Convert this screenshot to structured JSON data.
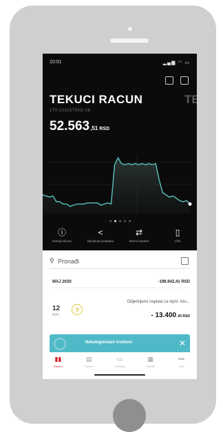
{
  "status": {
    "time": "10:01",
    "icons": "▂▄▆ ◠ ▭"
  },
  "account": {
    "title": "TEKUCI RACUN",
    "next_title": "TE",
    "number": "170-10115700O-28",
    "balance_main": "52.563",
    "balance_decimal": ",51",
    "currency": "RSD"
  },
  "balance_chart": {
    "color": "#55b8b4",
    "values": [
      62,
      63,
      64,
      63,
      68,
      68,
      70,
      70,
      72,
      71,
      70,
      70,
      70,
      69,
      69,
      69,
      69,
      71,
      70,
      69,
      70,
      36,
      30,
      35,
      36,
      35,
      36,
      35,
      36,
      35,
      36,
      35,
      36,
      35,
      49,
      60,
      62,
      64,
      63,
      65,
      67,
      68,
      67,
      70
    ]
  },
  "pager": {
    "count": 5,
    "active": 1
  },
  "actions": [
    {
      "icon": "info-icon",
      "glyph": "ⓘ",
      "label": "Detalji računa"
    },
    {
      "icon": "share-icon",
      "glyph": "<",
      "label": "Dijeljenje podataka"
    },
    {
      "icon": "transfer-icon",
      "glyph": "⇄",
      "label": "Interni transfer"
    },
    {
      "icon": "phone-icon",
      "glyph": "▯",
      "label": "Više"
    }
  ],
  "search": {
    "placeholder": "Pronađi"
  },
  "transactions_header": {
    "month": "MAJ 2020",
    "total": "-198.942,41 RSD"
  },
  "transaction": {
    "day": "12",
    "month": "MAJ",
    "icon": "?",
    "description": "Odjednjeno naplata za April, Istu...",
    "amount_main": "- 13.400",
    "amount_decimal": ",00 RSD"
  },
  "banner": {
    "text": "Nekategorisani troškovi",
    "close": "✕"
  },
  "tabs": [
    {
      "name": "tab-racuni",
      "glyph": "▮▮",
      "label": "Računi",
      "active": true
    },
    {
      "name": "tab-kartice",
      "glyph": "▤",
      "label": "Kartice",
      "active": false
    },
    {
      "name": "tab-placanja",
      "glyph": "▭",
      "label": "Plaćanja",
      "active": false
    },
    {
      "name": "tab-krediti",
      "glyph": "▦",
      "label": "Krediti",
      "active": false
    },
    {
      "name": "tab-vise",
      "glyph": "•••",
      "label": "Više",
      "active": false
    }
  ]
}
